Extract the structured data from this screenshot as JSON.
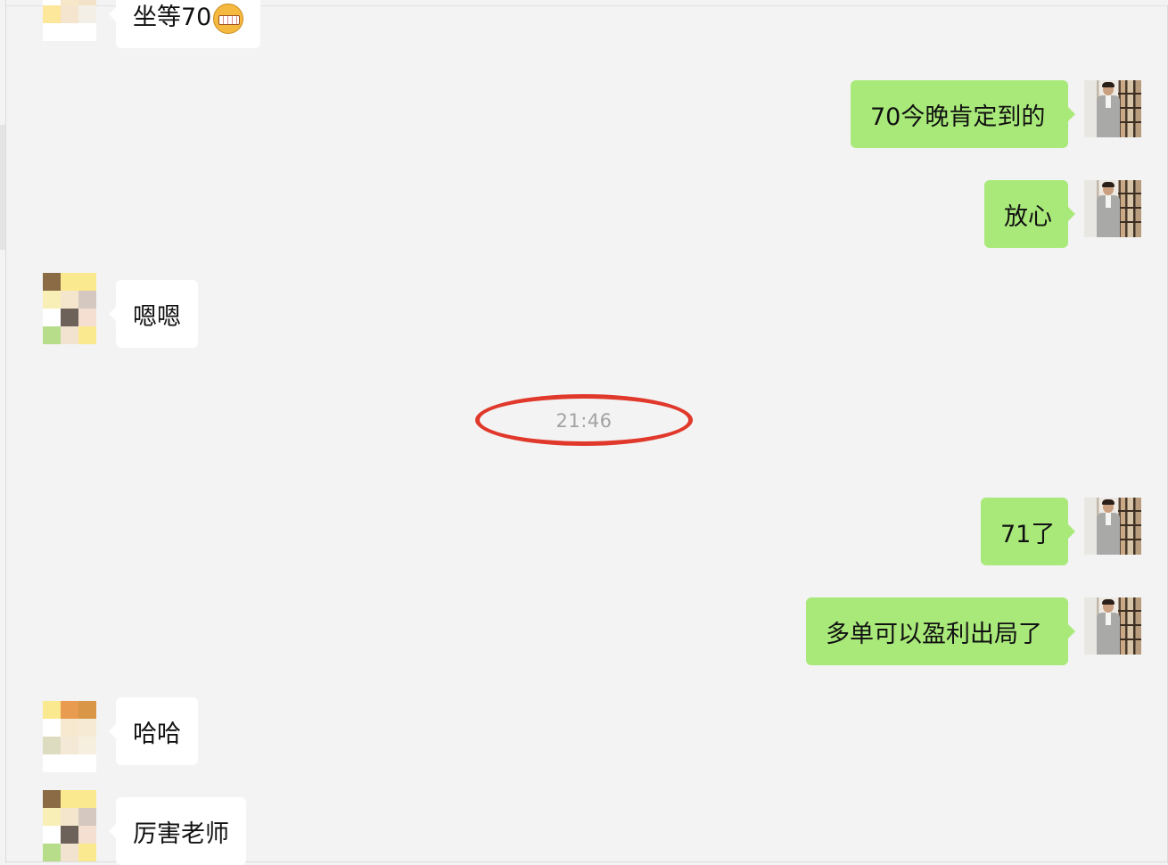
{
  "chat": {
    "timestamp": "21:46",
    "messages": [
      {
        "side": "in",
        "text": "坐等70",
        "emoji": "grinning-face-icon"
      },
      {
        "side": "out",
        "text": "70今晚肯定到的"
      },
      {
        "side": "out",
        "text": "放心"
      },
      {
        "side": "in",
        "text": "嗯嗯"
      },
      {
        "side": "out",
        "text": "71了"
      },
      {
        "side": "out",
        "text": "多单可以盈利出局了"
      },
      {
        "side": "in",
        "text": "哈哈"
      },
      {
        "side": "in",
        "text": "厉害老师"
      }
    ]
  },
  "colors": {
    "background": "#f3f3f3",
    "incoming_bubble": "#ffffff",
    "outgoing_bubble": "#a9e97a",
    "highlight_ellipse": "#e0392b",
    "timestamp_text": "#a3a3a3"
  },
  "icons": {
    "incoming_avatar": "pixelated-avatar-icon",
    "outgoing_avatar": "user-photo-avatar-icon",
    "emoji": "grinning-face-icon"
  }
}
